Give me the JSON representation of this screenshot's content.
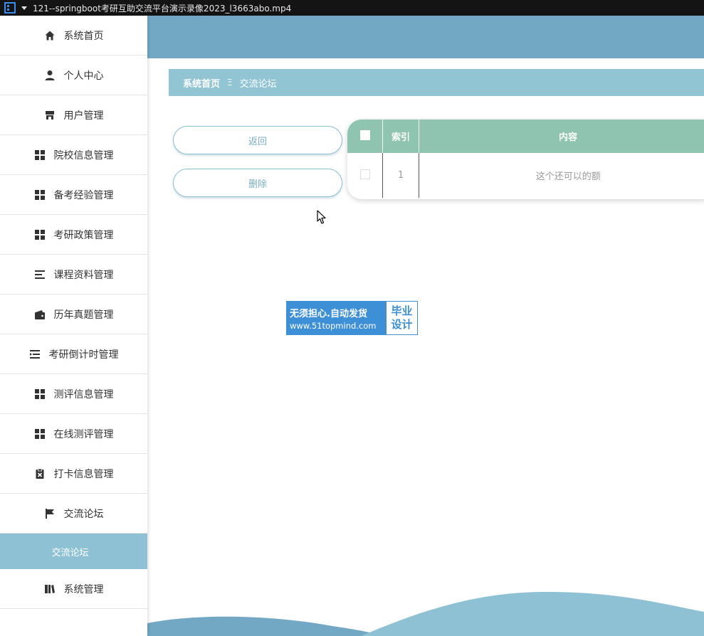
{
  "window": {
    "title": "121--springboot考研互助交流平台演示录像2023_l3663abo.mp4"
  },
  "sidebar": {
    "items": [
      {
        "label": "系统首页",
        "icon": "home-icon"
      },
      {
        "label": "个人中心",
        "icon": "user-icon"
      },
      {
        "label": "用户管理",
        "icon": "store-icon"
      },
      {
        "label": "院校信息管理",
        "icon": "grid-icon"
      },
      {
        "label": "备考经验管理",
        "icon": "grid-icon"
      },
      {
        "label": "考研政策管理",
        "icon": "grid-icon"
      },
      {
        "label": "课程资料管理",
        "icon": "list-icon"
      },
      {
        "label": "历年真题管理",
        "icon": "wallet-icon"
      },
      {
        "label": "考研倒计时管理",
        "icon": "indent-icon"
      },
      {
        "label": "测评信息管理",
        "icon": "grid-icon"
      },
      {
        "label": "在线测评管理",
        "icon": "grid-icon"
      },
      {
        "label": "打卡信息管理",
        "icon": "clipboard-icon"
      },
      {
        "label": "交流论坛",
        "icon": "flag-icon"
      }
    ],
    "active_sub": "交流论坛",
    "last_item": {
      "label": "系统管理",
      "icon": "book-icon"
    }
  },
  "breadcrumb": {
    "home": "系统首页",
    "separator": "Ξ",
    "current": "交流论坛"
  },
  "actions": {
    "back_label": "返回",
    "delete_label": "删除"
  },
  "table": {
    "headers": {
      "index": "索引",
      "content": "内容"
    },
    "rows": [
      {
        "index": "1",
        "content": "这个还可以的额"
      }
    ]
  },
  "watermark": {
    "line1": "无须担心.自动发货",
    "line2": "www.51topmind.com",
    "right1": "毕业",
    "right2": "设计"
  },
  "colors": {
    "header": "#73a8c4",
    "breadcrumb": "#92c5d4",
    "table_header": "#8ec4b0",
    "active_sub": "#8fc1d4",
    "watermark": "#3d8fd6"
  }
}
